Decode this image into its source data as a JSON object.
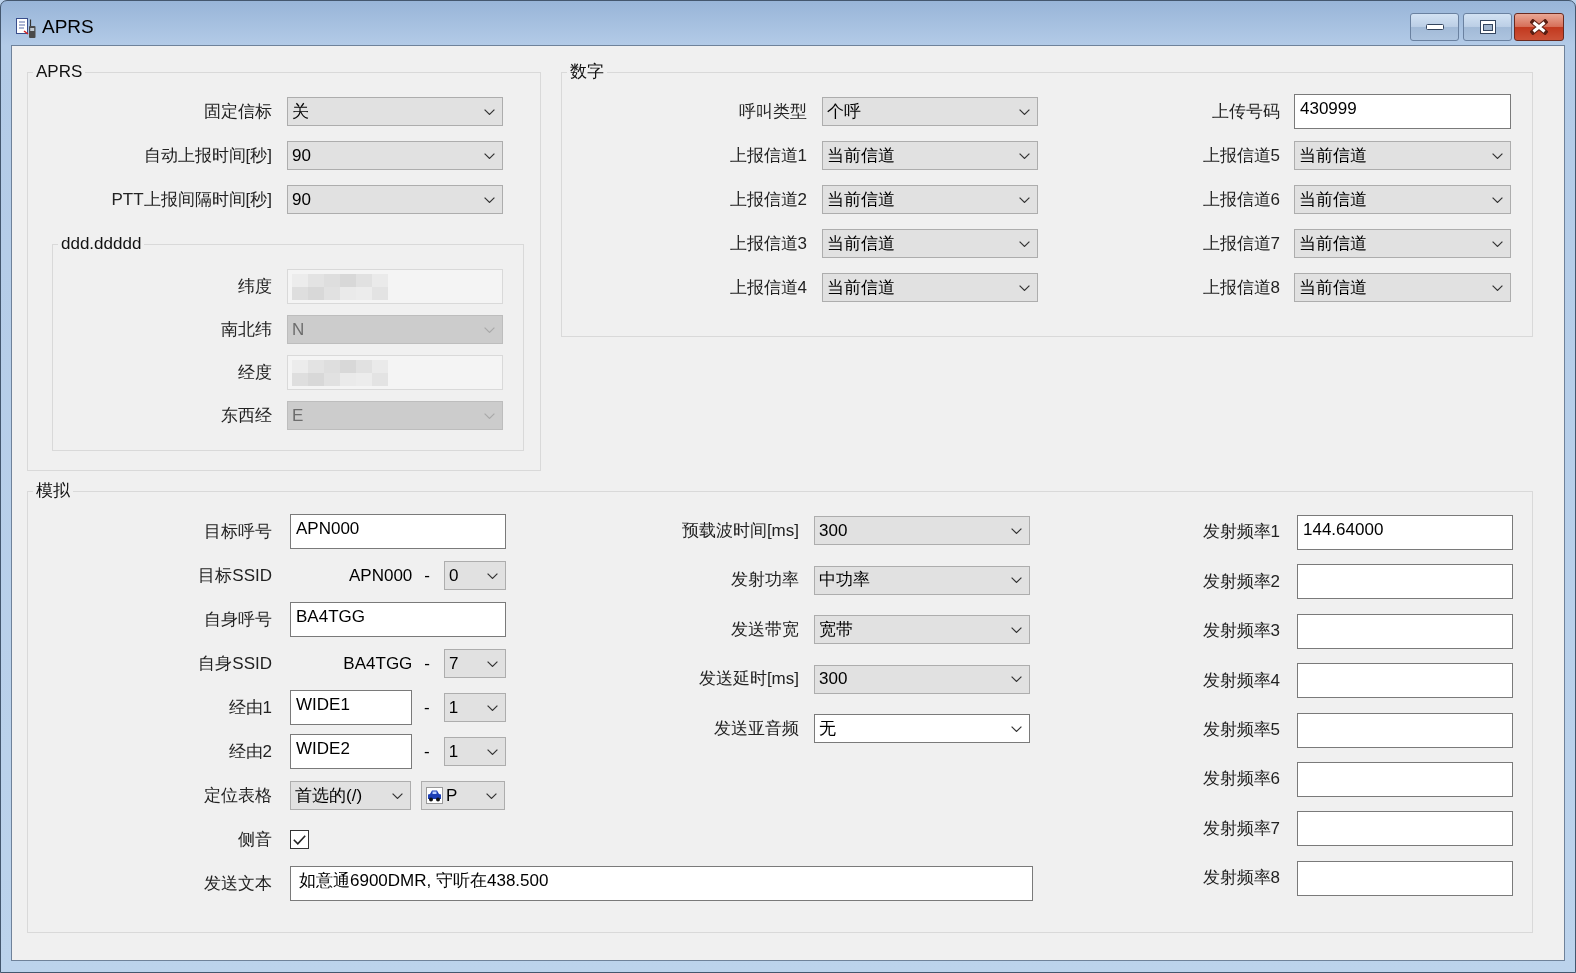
{
  "window": {
    "title": "APRS"
  },
  "aprs": {
    "title": "APRS",
    "rows": [
      {
        "label": "固定信标",
        "kind": "dropdown",
        "value": "关"
      },
      {
        "label": "自动上报时间[秒]",
        "kind": "dropdown",
        "value": "90"
      },
      {
        "label": "PTT上报间隔时间[秒]",
        "kind": "dropdown",
        "value": "90"
      }
    ],
    "coordinates": {
      "title": "ddd.ddddd",
      "rows": [
        {
          "label": "纬度",
          "kind": "text",
          "disabled": true,
          "redacted": true
        },
        {
          "label": "南北纬",
          "kind": "dropdown",
          "value": "N",
          "disabled": true,
          "redacted": false
        },
        {
          "label": "经度",
          "kind": "text",
          "disabled": true,
          "redacted": true
        },
        {
          "label": "东西经",
          "kind": "dropdown",
          "value": "E",
          "disabled": true,
          "redacted": false
        }
      ]
    }
  },
  "digital": {
    "title": "数字",
    "columns": [
      {
        "rows": [
          {
            "label": "呼叫类型",
            "kind": "dropdown",
            "value": "个呼"
          },
          {
            "label": "上报信道1",
            "kind": "dropdown",
            "value": "当前信道"
          },
          {
            "label": "上报信道2",
            "kind": "dropdown",
            "value": "当前信道"
          },
          {
            "label": "上报信道3",
            "kind": "dropdown",
            "value": "当前信道"
          },
          {
            "label": "上报信道4",
            "kind": "dropdown",
            "value": "当前信道"
          }
        ]
      },
      {
        "rows": [
          {
            "label": "上传号码",
            "kind": "text",
            "value": "430999"
          },
          {
            "label": "上报信道5",
            "kind": "dropdown",
            "value": "当前信道"
          },
          {
            "label": "上报信道6",
            "kind": "dropdown",
            "value": "当前信道"
          },
          {
            "label": "上报信道7",
            "kind": "dropdown",
            "value": "当前信道"
          },
          {
            "label": "上报信道8",
            "kind": "dropdown",
            "value": "当前信道"
          }
        ]
      }
    ]
  },
  "analog": {
    "title": "模拟",
    "left": [
      {
        "label": "目标呼号",
        "kind": "text",
        "value": "APN000"
      },
      {
        "label": "目标SSID",
        "kind": "ssid",
        "callsign": "APN000",
        "separator": "-",
        "value": "0"
      },
      {
        "label": "自身呼号",
        "kind": "text",
        "value": "BA4TGG"
      },
      {
        "label": "自身SSID",
        "kind": "ssid",
        "callsign": "BA4TGG",
        "separator": "-",
        "value": "7"
      },
      {
        "label": "经由1",
        "kind": "path",
        "value": "WIDE1",
        "separator": "-",
        "dropdown_value": "1"
      },
      {
        "label": "经由2",
        "kind": "path",
        "value": "WIDE2",
        "separator": "-",
        "dropdown_value": "1"
      },
      {
        "label": "定位表格",
        "kind": "symbol",
        "table": "首选的(/)",
        "symbol": "P"
      },
      {
        "label": "侧音",
        "kind": "checkbox",
        "checked": true
      }
    ],
    "middle": [
      {
        "label": "预载波时间[ms]",
        "kind": "dropdown",
        "value": "300"
      },
      {
        "label": "发射功率",
        "kind": "dropdown",
        "value": "中功率"
      },
      {
        "label": "发送带宽",
        "kind": "dropdown",
        "value": "宽带"
      },
      {
        "label": "发送延时[ms]",
        "kind": "dropdown",
        "value": "300"
      },
      {
        "label": "发送亚音频",
        "kind": "editable-dropdown",
        "value": "无"
      }
    ],
    "right": [
      {
        "label": "发射频率1",
        "kind": "text",
        "value": "144.64000"
      },
      {
        "label": "发射频率2",
        "kind": "text"
      },
      {
        "label": "发射频率3",
        "kind": "text"
      },
      {
        "label": "发射频率4",
        "kind": "text"
      },
      {
        "label": "发射频率5",
        "kind": "text"
      },
      {
        "label": "发射频率6",
        "kind": "text"
      },
      {
        "label": "发射频率7",
        "kind": "text"
      },
      {
        "label": "发射频率8",
        "kind": "text"
      }
    ],
    "send_text": {
      "label": "发送文本",
      "kind": "text",
      "value": "如意通6900DMR, 守听在438.500"
    }
  }
}
